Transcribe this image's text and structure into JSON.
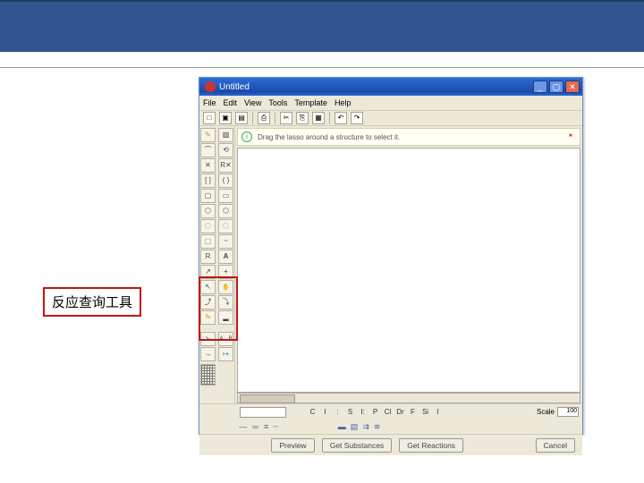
{
  "callout": {
    "text": "反应查询工具"
  },
  "window": {
    "title": "Untitled",
    "menus": [
      "File",
      "Edit",
      "View",
      "Tools",
      "Template",
      "Help"
    ],
    "hint": "Drag the lasso around a structure to select it.",
    "elements": [
      "C",
      "I",
      ":",
      "S",
      "I:",
      "P",
      "Cl",
      "Dr",
      "F",
      "Si",
      "I"
    ],
    "scale_label": "Scale",
    "scale_value": "100",
    "buttons": {
      "preview": "Preview",
      "get_subs": "Get Substances",
      "get_rxn": "Get Reactions",
      "cancel": "Cancel"
    },
    "atob": "A→B"
  }
}
